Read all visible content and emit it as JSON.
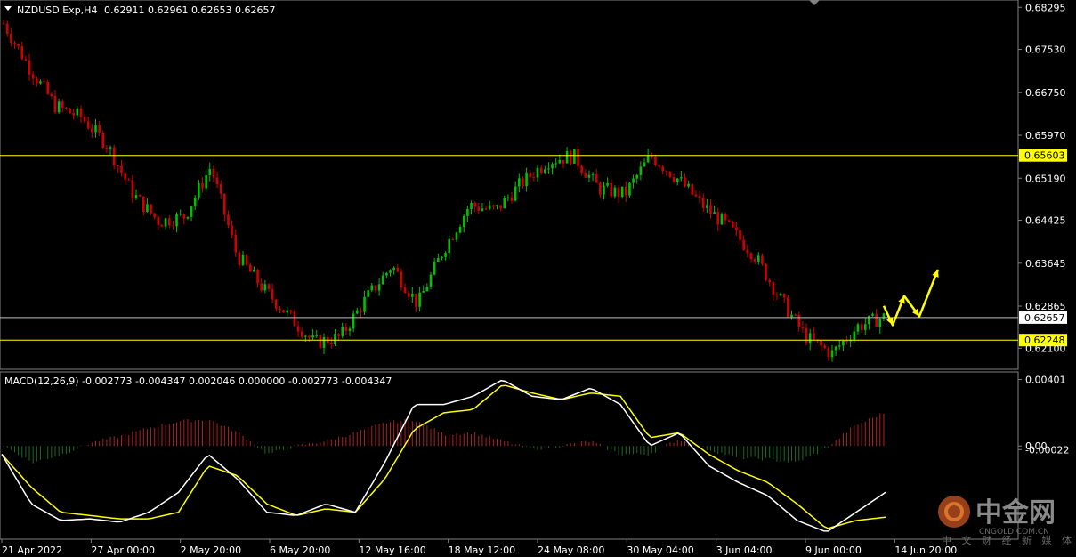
{
  "header": {
    "symbol": "NZDUSD.Exp,H4",
    "ohlc": "0.62911 0.62961 0.62653 0.62657"
  },
  "macd_header": {
    "text": "MACD(12,26,9) -0.002773 -0.004347 0.002046 0.000000 -0.002773 -0.004347"
  },
  "price_axis": [
    "0.68295",
    "0.67530",
    "0.66750",
    "0.65970",
    "0.65190",
    "0.64425",
    "0.63645",
    "0.62865",
    "0.62100"
  ],
  "macd_axis": [
    "0.00401",
    "0.00",
    "-0.00022"
  ],
  "time_axis": [
    "21 Apr 2022",
    "27 Apr 00:00",
    "2 May 20:00",
    "6 May 20:00",
    "12 May 16:00",
    "18 May 12:00",
    "24 May 08:00",
    "30 May 04:00",
    "3 Jun 04:00",
    "9 Jun 00:00",
    "14 Jun 20:00"
  ],
  "levels": {
    "resistance": "0.65603",
    "current": "0.62657",
    "support": "0.62248"
  },
  "watermark": {
    "title": "中金网",
    "subtitle": "中 文 财 经 新 媒 体",
    "url": "CNGOLD.COM.CN"
  },
  "colors": {
    "background": "#000000",
    "bull": "#00c000",
    "bear": "#d00000",
    "level_line": "#ffff00",
    "current_line": "#c0c0c0",
    "macd_line": "#ffffff",
    "signal_line": "#ffff00",
    "projection": "#ffff00"
  },
  "chart_data": [
    {
      "type": "candlestick",
      "title": "NZDUSD.Exp,H4",
      "ylim": [
        0.6196,
        0.6838
      ],
      "x": [
        "21 Apr 2022",
        "27 Apr 00:00",
        "2 May 20:00",
        "6 May 20:00",
        "12 May 16:00",
        "18 May 12:00",
        "24 May 08:00",
        "30 May 04:00",
        "3 Jun 04:00",
        "9 Jun 00:00",
        "14 Jun 20:00"
      ],
      "close_path": [
        0.68,
        0.672,
        0.665,
        0.663,
        0.658,
        0.649,
        0.644,
        0.645,
        0.654,
        0.638,
        0.632,
        0.627,
        0.622,
        0.623,
        0.63,
        0.636,
        0.629,
        0.639,
        0.647,
        0.646,
        0.651,
        0.655,
        0.656,
        0.65,
        0.649,
        0.656,
        0.652,
        0.647,
        0.643,
        0.638,
        0.63,
        0.623,
        0.62,
        0.625,
        0.6266
      ],
      "horizontal_lines": [
        0.65603,
        0.62248
      ],
      "last_price": 0.62657,
      "grid": false
    },
    {
      "type": "line",
      "title": "MACD(12,26,9)",
      "ylim": [
        -0.0052,
        0.0042
      ],
      "series": [
        {
          "name": "MACD",
          "values": [
            -0.0005,
            -0.0035,
            -0.0045,
            -0.0044,
            -0.0046,
            -0.004,
            -0.0028,
            -0.0005,
            -0.002,
            -0.004,
            -0.0042,
            -0.0035,
            -0.004,
            -0.001,
            0.0025,
            0.0025,
            0.003,
            0.004,
            0.003,
            0.0028,
            0.0035,
            0.0025,
            0.0,
            0.0008,
            -0.0012,
            -0.0022,
            -0.003,
            -0.0045,
            -0.0052,
            -0.004,
            -0.0028
          ]
        },
        {
          "name": "Signal",
          "values": [
            -0.0005,
            -0.0025,
            -0.004,
            -0.0042,
            -0.0044,
            -0.0044,
            -0.004,
            -0.0012,
            -0.0018,
            -0.0035,
            -0.0042,
            -0.0038,
            -0.004,
            -0.002,
            0.001,
            0.002,
            0.0022,
            0.0037,
            0.0032,
            0.0028,
            0.0032,
            0.003,
            0.0005,
            0.0008,
            -0.0005,
            -0.0015,
            -0.0022,
            -0.0035,
            -0.005,
            -0.0045,
            -0.0043
          ]
        },
        {
          "name": "Histogram",
          "values": [
            0.0,
            -0.001,
            -0.0005,
            0.0002,
            0.0006,
            0.0011,
            0.0015,
            0.0016,
            0.0008,
            -0.0005,
            0.0,
            0.0003,
            0.0008,
            0.0014,
            0.0016,
            0.0007,
            0.0008,
            0.0003,
            -0.0002,
            0.0,
            0.0003,
            -0.0005,
            -0.0005,
            0.0004,
            -0.0002,
            -0.0007,
            -0.0008,
            -0.001,
            -0.0002,
            0.0012,
            0.002
          ]
        }
      ],
      "grid": false
    }
  ]
}
